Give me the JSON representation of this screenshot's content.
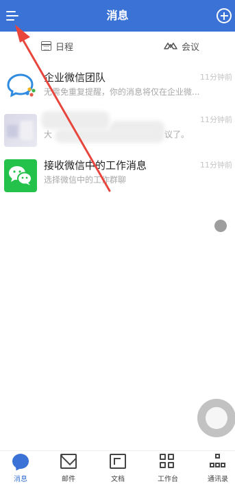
{
  "header": {
    "title": "消息"
  },
  "subtabs": {
    "schedule": "日程",
    "meeting": "会议"
  },
  "conversations": [
    {
      "name": "企业微信团队",
      "preview": "无需免重复提醒，你的消息将仅在企业微...",
      "time": "11分钟前"
    },
    {
      "name": "",
      "preview": "大",
      "preview_tail": "议了。",
      "time": "11分钟前"
    },
    {
      "name": "接收微信中的工作消息",
      "preview": "选择微信中的工作群聊",
      "time": "11分钟前"
    }
  ],
  "bottom_nav": [
    {
      "label": "消息",
      "icon": "chat-icon",
      "active": true
    },
    {
      "label": "邮件",
      "icon": "mail-icon"
    },
    {
      "label": "文档",
      "icon": "document-icon"
    },
    {
      "label": "工作台",
      "icon": "grid-icon"
    },
    {
      "label": "通讯录",
      "icon": "contacts-icon"
    }
  ],
  "colors": {
    "accent": "#3a72d6",
    "wechat_green": "#24c24b",
    "arrow": "#e8453c"
  }
}
